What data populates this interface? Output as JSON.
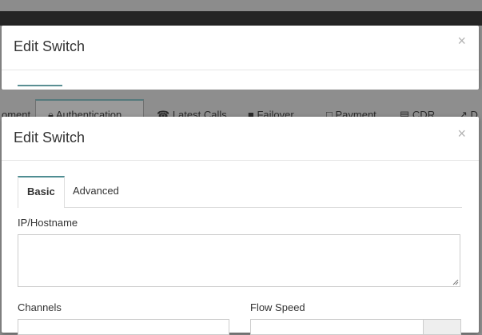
{
  "back_modal": {
    "title": "Edit Switch",
    "close_symbol": "×"
  },
  "background_nav": {
    "items": [
      "oment",
      "Authentication",
      "Latest Calls",
      "Failover",
      "Payment",
      "CDR",
      "D"
    ],
    "icons": [
      "lock-icon",
      "phone-icon",
      "users-icon",
      "dollar-icon",
      "list-icon",
      "external-link-icon"
    ]
  },
  "modal": {
    "title": "Edit Switch",
    "close_symbol": "×",
    "tabs": [
      {
        "label": "Basic",
        "active": true
      },
      {
        "label": "Advanced",
        "active": false
      }
    ],
    "fields": {
      "ip_hostname": {
        "label": "IP/Hostname",
        "value": ""
      },
      "channels": {
        "label": "Channels",
        "value": ""
      },
      "flow_speed": {
        "label": "Flow Speed",
        "value": ""
      }
    }
  },
  "colors": {
    "accent_tab": "#4f8d92",
    "overlay": "#8f8f8f",
    "dark_band": "#252525"
  }
}
